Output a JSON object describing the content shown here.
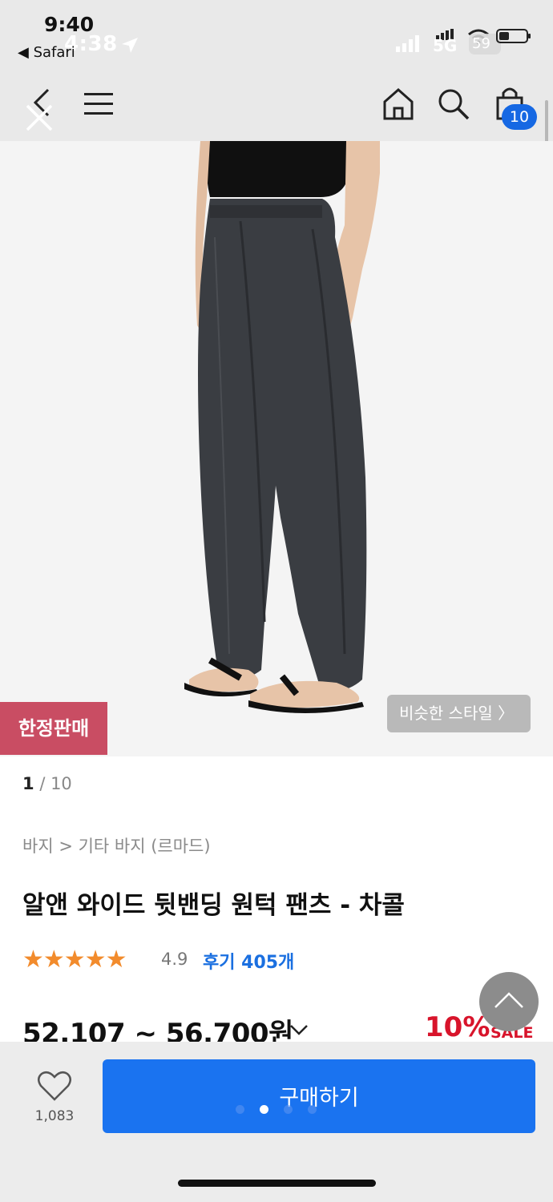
{
  "status_bar": {
    "time_primary": "9:40",
    "time_overlay": "4:38",
    "back_app": "◀ Safari",
    "network": "5G",
    "battery": "59"
  },
  "header": {
    "cart_count": "10"
  },
  "image": {
    "badge": "한정판매",
    "similar_style": "비슷한 스타일  〉",
    "page_current": "1",
    "page_total": "/ 10"
  },
  "product": {
    "breadcrumb": "바지 > 기타 바지 (르마드)",
    "title": "알앤 와이드 뒷밴딩 원턱 팬츠 - 차콜",
    "stars": "★★★★★",
    "rating": "4.9",
    "reviews": "후기 405개",
    "price": "52,107 ~ 56,700원",
    "discount": "10%",
    "sale": "SALE"
  },
  "bottom_bar": {
    "likes": "1,083",
    "buy_label": "구매하기"
  },
  "colors": {
    "accent": "#1a73f0",
    "sale": "#d8142b",
    "limited_badge": "#c94d63",
    "star": "#f28b2c"
  }
}
